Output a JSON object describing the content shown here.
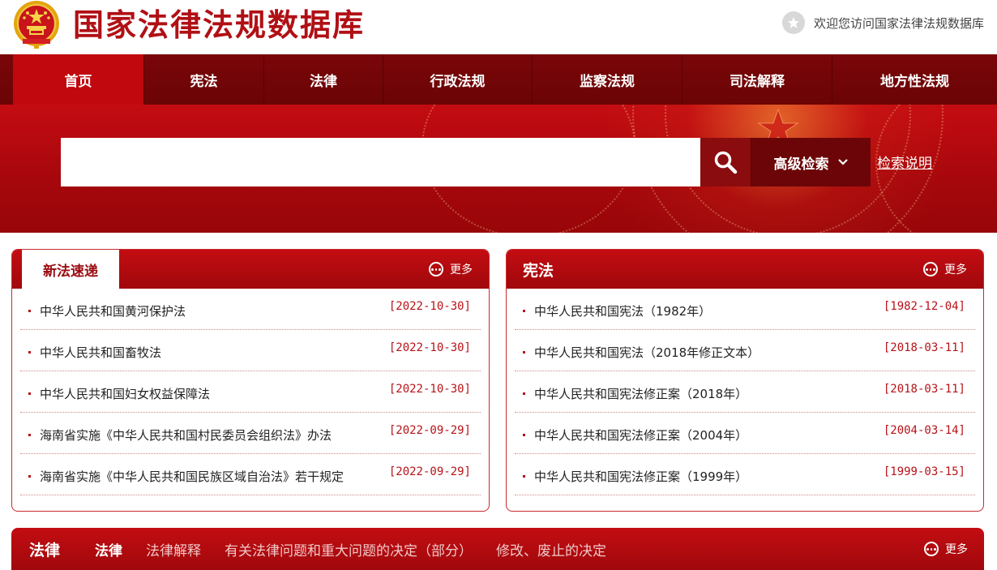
{
  "header": {
    "site_title": "国家法律法规数据库",
    "welcome": "欢迎您访问国家法律法规数据库",
    "brand_color": "#b01015"
  },
  "nav": {
    "items": [
      {
        "label": "首页",
        "active": true
      },
      {
        "label": "宪法"
      },
      {
        "label": "法律"
      },
      {
        "label": "行政法规"
      },
      {
        "label": "监察法规"
      },
      {
        "label": "司法解释"
      },
      {
        "label": "地方性法规"
      }
    ]
  },
  "search": {
    "placeholder": "",
    "advanced_label": "高级检索",
    "help_label": "检索说明",
    "icon": "search-icon"
  },
  "new_laws": {
    "tab_label": "新法速递",
    "more_label": "更多",
    "items": [
      {
        "title": "中华人民共和国黄河保护法",
        "date": "[2022-10-30]"
      },
      {
        "title": "中华人民共和国畜牧法",
        "date": "[2022-10-30]"
      },
      {
        "title": "中华人民共和国妇女权益保障法",
        "date": "[2022-10-30]"
      },
      {
        "title": "海南省实施《中华人民共和国村民委员会组织法》办法",
        "date": "[2022-09-29]"
      },
      {
        "title": "海南省实施《中华人民共和国民族区域自治法》若干规定",
        "date": "[2022-09-29]"
      }
    ]
  },
  "constitution": {
    "title": "宪法",
    "more_label": "更多",
    "items": [
      {
        "title": "中华人民共和国宪法（1982年）",
        "date": "[1982-12-04]"
      },
      {
        "title": "中华人民共和国宪法（2018年修正文本）",
        "date": "[2018-03-11]"
      },
      {
        "title": "中华人民共和国宪法修正案（2018年）",
        "date": "[2018-03-11]"
      },
      {
        "title": "中华人民共和国宪法修正案（2004年）",
        "date": "[2004-03-14]"
      },
      {
        "title": "中华人民共和国宪法修正案（1999年）",
        "date": "[1999-03-15]"
      }
    ]
  },
  "law_section": {
    "title": "法律",
    "more_label": "更多",
    "tabs": [
      {
        "label": "法律",
        "active": true
      },
      {
        "label": "法律解释"
      },
      {
        "label": "有关法律问题和重大问题的决定（部分）"
      },
      {
        "label": "修改、废止的决定"
      }
    ]
  },
  "colors": {
    "nav_bg": "#6b0406",
    "nav_active": "#c0080e",
    "panel_red": "#b00a0f",
    "date_red": "#b71217"
  }
}
